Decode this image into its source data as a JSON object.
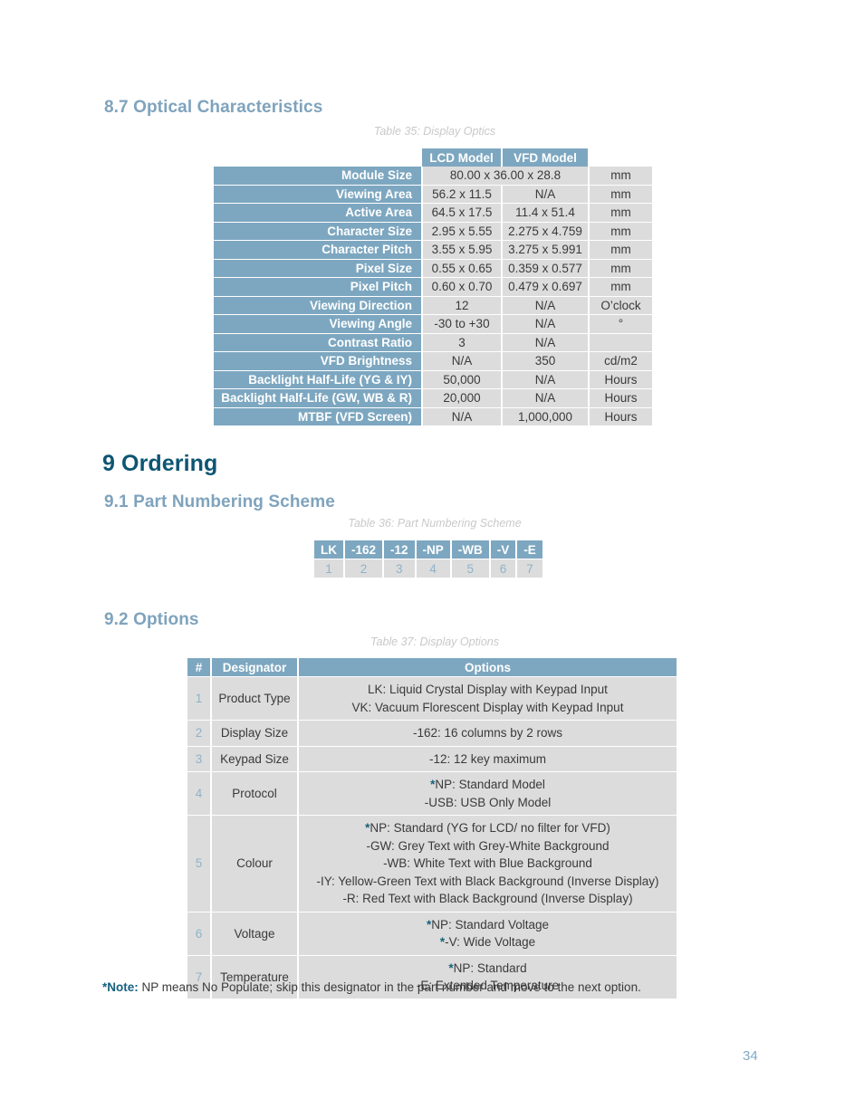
{
  "sections": {
    "optical": {
      "heading": "8.7 Optical Characteristics",
      "caption": "Table 35: Display Optics"
    },
    "ordering": {
      "heading": "9 Ordering"
    },
    "part_numbering": {
      "heading": "9.1 Part Numbering Scheme",
      "caption": "Table 36: Part Numbering Scheme"
    },
    "options": {
      "heading": "9.2 Options",
      "caption": "Table 37: Display Options"
    }
  },
  "optics_table": {
    "headers": [
      "",
      "LCD Model",
      "VFD Model",
      ""
    ],
    "rows": [
      {
        "label": "Module Size",
        "lcd": "80.00 x 36.00 x 28.8",
        "vfd": "",
        "span": true,
        "unit": "mm"
      },
      {
        "label": "Viewing Area",
        "lcd": "56.2 x 11.5",
        "vfd": "N/A",
        "span": false,
        "unit": "mm"
      },
      {
        "label": "Active Area",
        "lcd": "64.5 x 17.5",
        "vfd": "11.4 x 51.4",
        "span": false,
        "unit": "mm"
      },
      {
        "label": "Character Size",
        "lcd": "2.95 x 5.55",
        "vfd": "2.275 x 4.759",
        "span": false,
        "unit": "mm"
      },
      {
        "label": "Character Pitch",
        "lcd": "3.55 x 5.95",
        "vfd": "3.275 x 5.991",
        "span": false,
        "unit": "mm"
      },
      {
        "label": "Pixel Size",
        "lcd": "0.55 x 0.65",
        "vfd": "0.359 x 0.577",
        "span": false,
        "unit": "mm"
      },
      {
        "label": "Pixel Pitch",
        "lcd": "0.60 x 0.70",
        "vfd": "0.479 x 0.697",
        "span": false,
        "unit": "mm"
      },
      {
        "label": "Viewing Direction",
        "lcd": "12",
        "vfd": "N/A",
        "span": false,
        "unit": "O’clock"
      },
      {
        "label": "Viewing Angle",
        "lcd": "-30 to +30",
        "vfd": "N/A",
        "span": false,
        "unit": "°"
      },
      {
        "label": "Contrast Ratio",
        "lcd": "3",
        "vfd": "N/A",
        "span": false,
        "unit": ""
      },
      {
        "label": "VFD Brightness",
        "lcd": "N/A",
        "vfd": "350",
        "span": false,
        "unit": "cd/m2"
      },
      {
        "label": "Backlight Half-Life (YG & IY)",
        "lcd": "50,000",
        "vfd": "N/A",
        "span": false,
        "unit": "Hours"
      },
      {
        "label": "Backlight Half-Life (GW, WB & R)",
        "lcd": "20,000",
        "vfd": "N/A",
        "span": false,
        "unit": "Hours"
      },
      {
        "label": "MTBF (VFD Screen)",
        "lcd": "N/A",
        "vfd": "1,000,000",
        "span": false,
        "unit": "Hours"
      }
    ]
  },
  "part_number_table": {
    "codes": [
      "LK",
      "-162",
      "-12",
      "-NP",
      "-WB",
      "-V",
      "-E"
    ],
    "indices": [
      "1",
      "2",
      "3",
      "4",
      "5",
      "6",
      "7"
    ]
  },
  "options_table": {
    "headers": [
      "#",
      "Designator",
      "Options"
    ],
    "rows": [
      {
        "num": "1",
        "designator": "Product Type",
        "lines": [
          {
            "star": false,
            "text": "LK: Liquid Crystal Display with Keypad Input"
          },
          {
            "star": false,
            "text": "VK: Vacuum Florescent Display with Keypad Input"
          }
        ]
      },
      {
        "num": "2",
        "designator": "Display Size",
        "lines": [
          {
            "star": false,
            "text": "-162: 16 columns by 2 rows"
          }
        ]
      },
      {
        "num": "3",
        "designator": "Keypad Size",
        "lines": [
          {
            "star": false,
            "text": "-12: 12 key maximum"
          }
        ]
      },
      {
        "num": "4",
        "designator": "Protocol",
        "lines": [
          {
            "star": true,
            "text": "NP: Standard Model"
          },
          {
            "star": false,
            "text": "-USB: USB Only Model"
          }
        ]
      },
      {
        "num": "5",
        "designator": "Colour",
        "lines": [
          {
            "star": true,
            "text": "NP: Standard (YG for LCD/ no filter for VFD)"
          },
          {
            "star": false,
            "text": "-GW: Grey Text with Grey-White Background"
          },
          {
            "star": false,
            "text": "-WB: White Text with Blue Background"
          },
          {
            "star": false,
            "text": "-IY: Yellow-Green Text with Black Background (Inverse Display)"
          },
          {
            "star": false,
            "text": "-R:  Red Text with Black Background (Inverse Display)"
          }
        ]
      },
      {
        "num": "6",
        "designator": "Voltage",
        "lines": [
          {
            "star": true,
            "text": "NP: Standard Voltage"
          },
          {
            "star": true,
            "text": "-V: Wide Voltage"
          }
        ]
      },
      {
        "num": "7",
        "designator": "Temperature",
        "lines": [
          {
            "star": true,
            "text": "NP: Standard"
          },
          {
            "star": false,
            "text": "-E: Extended Temperature"
          }
        ]
      }
    ]
  },
  "note": {
    "label": "*Note:",
    "text": " NP means No Populate; skip this designator in the part number and move to the next option."
  },
  "page_number": "34",
  "colors": {
    "table_header_blue": "#7da7c0",
    "table_cell_gray": "#dcdcdc",
    "heading_light_blue": "#7fa3bd",
    "heading_dark_blue": "#0d5573",
    "accent_teal": "#17607f",
    "caption_gray": "#c9c9c9",
    "page_number_blue": "#7fa9c6"
  }
}
